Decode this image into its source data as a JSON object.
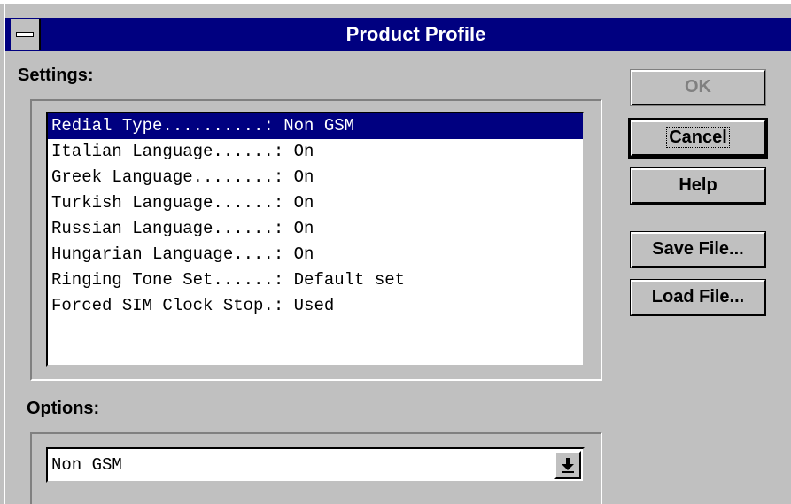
{
  "window": {
    "title": "Product Profile"
  },
  "settings": {
    "label": "Settings:",
    "items": [
      "Redial Type..........: Non GSM",
      "Italian Language......: On",
      "Greek Language........: On",
      "Turkish Language......: On",
      "Russian Language......: On",
      "Hungarian Language....: On",
      "Ringing Tone Set......: Default set",
      "Forced SIM Clock Stop.: Used"
    ],
    "selected_index": 0
  },
  "options": {
    "label": "Options:",
    "selected_value": "Non GSM"
  },
  "buttons": {
    "ok": "OK",
    "cancel": "Cancel",
    "help": "Help",
    "save_file": "Save File...",
    "load_file": "Load File..."
  },
  "colors": {
    "titlebar": "#000080",
    "face": "#c0c0c0",
    "selection": "#000080"
  },
  "icons": {
    "system_menu": "system-menu-icon",
    "dropdown": "dropdown-arrow-icon"
  }
}
